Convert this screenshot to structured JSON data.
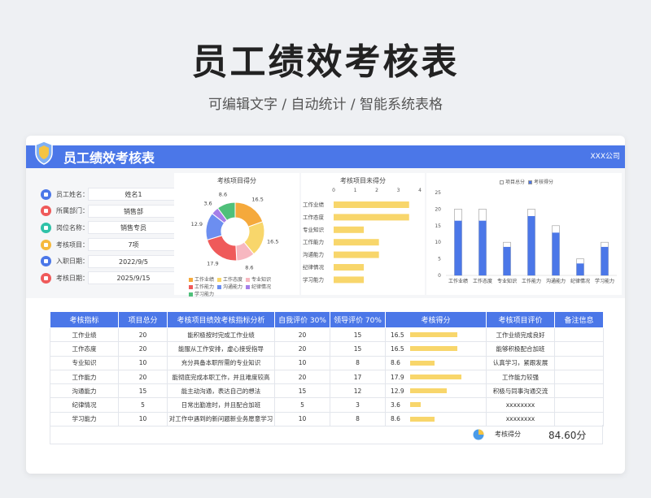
{
  "page": {
    "title": "员工绩效考核表",
    "subtitle": "可编辑文字 / 自动统计 / 智能系统表格"
  },
  "header": {
    "title": "员工绩效考核表",
    "company": "XXX公司"
  },
  "info": [
    {
      "label": "员工姓名：",
      "value": "姓名1",
      "icon": "user-icon",
      "color": "#4b77e8"
    },
    {
      "label": "所属部门：",
      "value": "销售部",
      "icon": "home-icon",
      "color": "#ef5a5a"
    },
    {
      "label": "岗位名称：",
      "value": "销售专员",
      "icon": "badge-icon",
      "color": "#2fc2a8"
    },
    {
      "label": "考核项目：",
      "value": "7项",
      "icon": "clipboard-icon",
      "color": "#f5b93c"
    },
    {
      "label": "入职日期：",
      "value": "2022/9/5",
      "icon": "calendar-icon",
      "color": "#4b77e8"
    },
    {
      "label": "考核日期：",
      "value": "2025/9/15",
      "icon": "calendar-check-icon",
      "color": "#ef5a5a"
    }
  ],
  "colors": {
    "accent": "#4b77e8",
    "bar_yellow": "#f8d66b",
    "palette": [
      "#f5a93c",
      "#f8d66b",
      "#f7b7c0",
      "#ef5a5a",
      "#6c8ef0",
      "#a57ee8",
      "#4fc07a"
    ]
  },
  "chart_data": [
    {
      "type": "pie",
      "title": "考核项目得分",
      "categories": [
        "工作业绩",
        "工作态度",
        "专业知识",
        "工作能力",
        "沟通能力",
        "纪律情况",
        "学习能力"
      ],
      "values": [
        16.5,
        16.5,
        8.6,
        17.9,
        12.9,
        3.6,
        8.6
      ]
    },
    {
      "type": "bar",
      "orientation": "horizontal",
      "title": "考核项目未得分",
      "categories": [
        "工作业绩",
        "工作态度",
        "专业知识",
        "工作能力",
        "沟通能力",
        "纪律情况",
        "学习能力"
      ],
      "values": [
        3.5,
        3.5,
        1.4,
        2.1,
        2.1,
        1.4,
        1.4
      ],
      "xlim": [
        0,
        4
      ],
      "xticks": [
        "0",
        "1",
        "2",
        "3",
        "4"
      ]
    },
    {
      "type": "bar",
      "title": "",
      "categories": [
        "工作业绩",
        "工作态度",
        "专业知识",
        "工作能力",
        "沟通能力",
        "纪律情况",
        "学习能力"
      ],
      "series": [
        {
          "name": "项目总分",
          "values": [
            20,
            20,
            10,
            20,
            15,
            5,
            10
          ]
        },
        {
          "name": "考核得分",
          "values": [
            16.5,
            16.5,
            8.6,
            17.9,
            12.9,
            3.6,
            8.6
          ]
        }
      ],
      "ylim": [
        0,
        25
      ],
      "yticks": [
        "0",
        "5",
        "10",
        "15",
        "20",
        "25"
      ]
    }
  ],
  "table": {
    "headers": [
      "考核指标",
      "项目总分",
      "考核项目绩效考核指标分析",
      "自我评价   30%",
      "领导评价     70%",
      "考核得分",
      "考核项目评价",
      "备注信息"
    ],
    "rows": [
      {
        "c": [
          "工作业绩",
          "20",
          "能积极按时完成工作业绩",
          "20",
          "15",
          "16.5",
          "工作业绩完成良好",
          ""
        ],
        "score": 16.5
      },
      {
        "c": [
          "工作态度",
          "20",
          "能服从工作安排，虚心接受指导",
          "20",
          "15",
          "16.5",
          "能够积极配合加班",
          ""
        ],
        "score": 16.5
      },
      {
        "c": [
          "专业知识",
          "10",
          "充分具备本职所需的专业知识",
          "10",
          "8",
          "8.6",
          "认真学习，紧跟发展",
          ""
        ],
        "score": 8.6
      },
      {
        "c": [
          "工作能力",
          "20",
          "能彻底完成本职工作，并且难度较高",
          "20",
          "17",
          "17.9",
          "工作能力较强",
          ""
        ],
        "score": 17.9
      },
      {
        "c": [
          "沟通能力",
          "15",
          "能主动沟通，表达自己的想法",
          "15",
          "12",
          "12.9",
          "积极与同事沟通交流",
          ""
        ],
        "score": 12.9
      },
      {
        "c": [
          "纪律情况",
          "5",
          "日常出勤准时，并且配合加班",
          "5",
          "3",
          "3.6",
          "xxxxxxxx",
          ""
        ],
        "score": 3.6
      },
      {
        "c": [
          "学习能力",
          "10",
          "对工作中遇到的新问题新业务愿意学习",
          "10",
          "8",
          "8.6",
          "xxxxxxxx",
          ""
        ],
        "score": 8.6
      }
    ],
    "score_max": 20
  },
  "summary": {
    "label": "考核得分",
    "value": "84.60分"
  }
}
